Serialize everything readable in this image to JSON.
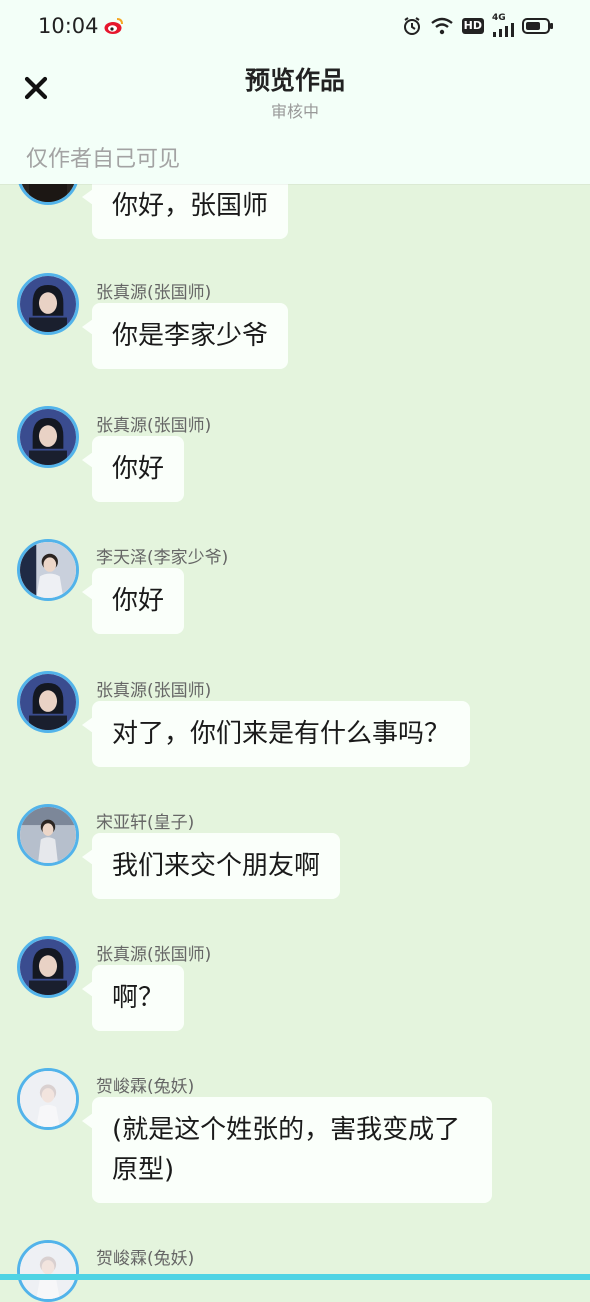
{
  "status_bar": {
    "time": "10:04",
    "hd": "HD",
    "network": "4G",
    "icons": [
      "weibo-icon",
      "alarm-icon",
      "wifi-icon",
      "hd-icon",
      "signal-icon",
      "battery-icon"
    ]
  },
  "header": {
    "close_icon": "close-icon",
    "title": "预览作品",
    "subtitle": "审核中",
    "visibility_note": "仅作者自己可见"
  },
  "messages": [
    {
      "sender": "",
      "text": "你好，张国师"
    },
    {
      "sender": "张真源(张国师)",
      "text": "你是李家少爷"
    },
    {
      "sender": "张真源(张国师)",
      "text": "你好"
    },
    {
      "sender": "李天泽(李家少爷)",
      "text": "你好"
    },
    {
      "sender": "张真源(张国师)",
      "text": "对了，你们来是有什么事吗？"
    },
    {
      "sender": "宋亚轩(皇子)",
      "text": "我们来交个朋友啊"
    },
    {
      "sender": "张真源(张国师)",
      "text": "啊？"
    },
    {
      "sender": "贺峻霖(兔妖)",
      "text": "(就是这个姓张的，害我变成了原型)"
    },
    {
      "sender": "贺峻霖(兔妖)",
      "text": ""
    }
  ],
  "colors": {
    "background": "#e4f4dd",
    "header_background": "#f3fff8",
    "bubble": "#fafffa",
    "avatar_border": "#52b3ea",
    "bottom_bar": "#4fd3e4"
  }
}
